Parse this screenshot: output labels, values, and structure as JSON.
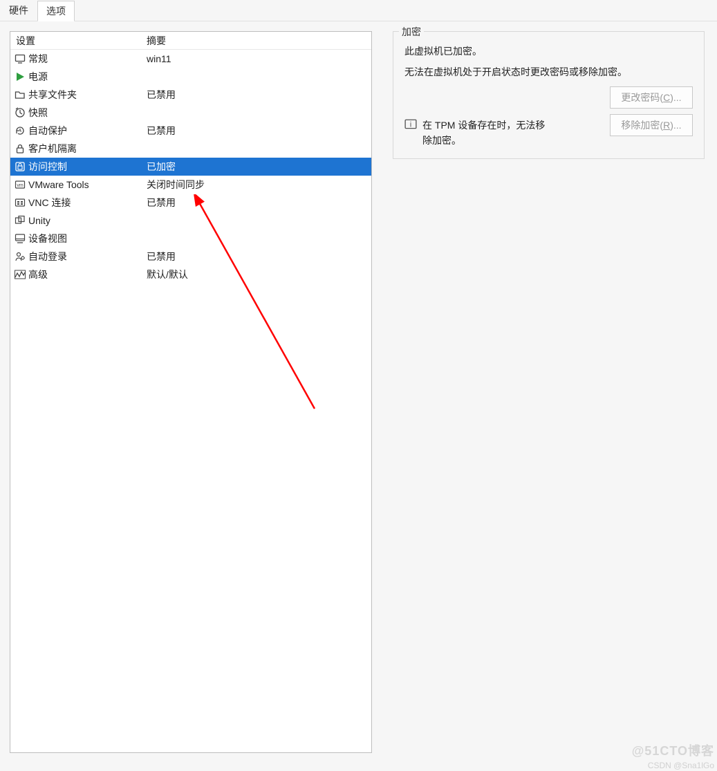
{
  "tabs": {
    "hardware": "硬件",
    "options": "选项"
  },
  "list": {
    "header_setting": "设置",
    "header_summary": "摘要",
    "rows": [
      {
        "label": "常规",
        "summary": "win11",
        "icon": "monitor"
      },
      {
        "label": "电源",
        "summary": "",
        "icon": "play"
      },
      {
        "label": "共享文件夹",
        "summary": "已禁用",
        "icon": "folder"
      },
      {
        "label": "快照",
        "summary": "",
        "icon": "clock-snap"
      },
      {
        "label": "自动保护",
        "summary": "已禁用",
        "icon": "history"
      },
      {
        "label": "客户机隔离",
        "summary": "",
        "icon": "lock"
      },
      {
        "label": "访问控制",
        "summary": "已加密",
        "icon": "shield",
        "selected": true
      },
      {
        "label": "VMware Tools",
        "summary": "关闭时间同步",
        "icon": "vm"
      },
      {
        "label": "VNC 连接",
        "summary": "已禁用",
        "icon": "vnc"
      },
      {
        "label": "Unity",
        "summary": "",
        "icon": "unity"
      },
      {
        "label": "设备视图",
        "summary": "",
        "icon": "device-view"
      },
      {
        "label": "自动登录",
        "summary": "已禁用",
        "icon": "autologin"
      },
      {
        "label": "高级",
        "summary": "默认/默认",
        "icon": "advanced"
      }
    ]
  },
  "right": {
    "group_title": "加密",
    "line1": "此虚拟机已加密。",
    "line2": "无法在虚拟机处于开启状态时更改密码或移除加密。",
    "button_change_pre": "更改密码(",
    "button_change_key": "C",
    "button_change_post": ")...",
    "button_remove_pre": "移除加密(",
    "button_remove_key": "R",
    "button_remove_post": ")...",
    "tpm_text": "在 TPM 设备存在时，无法移除加密。"
  },
  "watermark": {
    "w1": "@51CTO博客",
    "w2": "CSDN @Sna1lGo"
  }
}
